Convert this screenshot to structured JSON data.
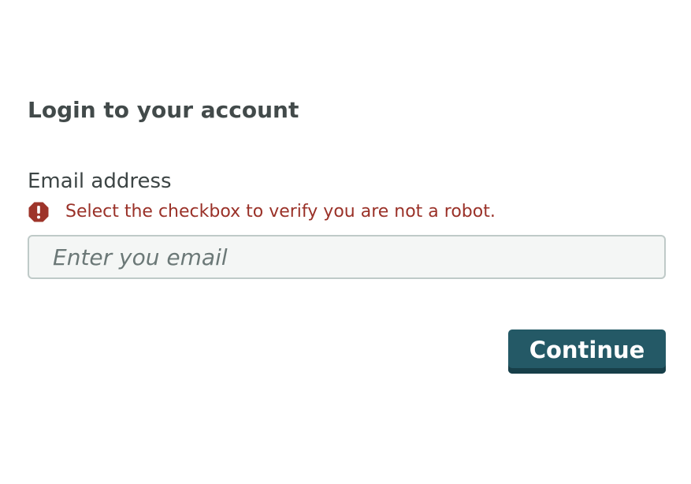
{
  "form": {
    "title": "Login to your account",
    "email_label": "Email address",
    "error_message": "Select the checkbox to verify you are not a robot.",
    "email_value": "",
    "email_placeholder": "Enter you email",
    "continue_label": "Continue"
  },
  "icons": {
    "error": "alert-octagon-icon"
  },
  "colors": {
    "title_text": "#424a4a",
    "error_text": "#9a3128",
    "error_icon": "#9e342a",
    "input_background": "#f4f6f5",
    "input_border": "#bfcac8",
    "button_background": "#245966",
    "button_text": "#ffffff"
  }
}
